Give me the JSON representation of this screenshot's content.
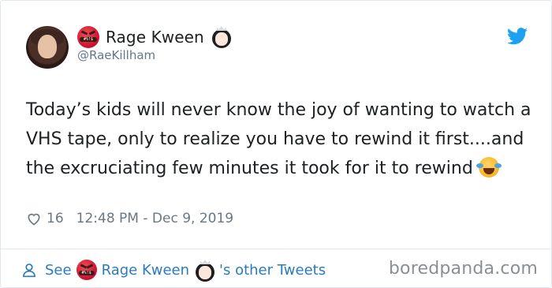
{
  "tweet": {
    "display_name": "Rage Kween",
    "handle": "@RaeKillham",
    "text": "Today’s kids will never know the joy of wanting to watch a VHS tape, only to realize you have to rewind it first....and the excruciating few minutes it took for it to rewind",
    "likes": "16",
    "timestamp": "12:48 PM - Dec 9, 2019",
    "icons": {
      "rage_emoji": "pouting-face-symbols-emoji",
      "princess_emoji": "princess-emoji",
      "joy_emoji": "face-with-tears-of-joy-emoji",
      "bird": "twitter-bird-icon",
      "heart": "heart-outline-icon",
      "person": "person-outline-icon"
    },
    "rage_bar_text": "#%!$"
  },
  "footer": {
    "see_label": "See",
    "name": "Rage Kween",
    "suffix": "'s other Tweets"
  },
  "watermark": "boredpanda.com",
  "colors": {
    "link": "#2b7bb9",
    "twitter_blue": "#1da1f2",
    "meta_gray": "#697882"
  }
}
